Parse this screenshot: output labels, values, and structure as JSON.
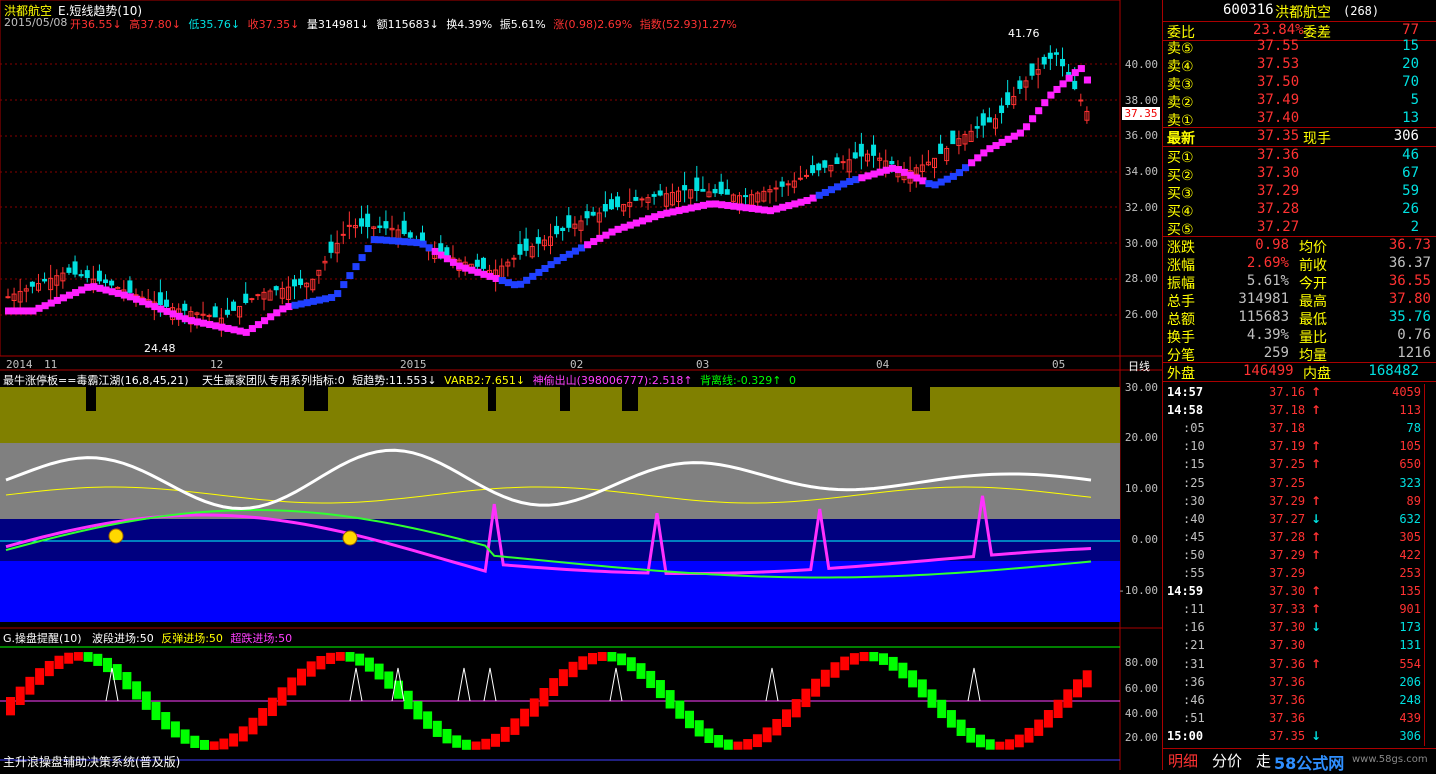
{
  "header": {
    "stock_name": "洪都航空",
    "indicator": "E.短线趋势(10)",
    "date": "2015/05/08",
    "quote": [
      {
        "label": "开",
        "value": "36.55",
        "arrow": "↓",
        "color": "red"
      },
      {
        "label": "高",
        "value": "37.80",
        "arrow": "↓",
        "color": "red"
      },
      {
        "label": "低",
        "value": "35.76",
        "arrow": "↓",
        "color": "cyan"
      },
      {
        "label": "收",
        "value": "37.35",
        "arrow": "↓",
        "color": "red"
      },
      {
        "label": "量",
        "value": "314981",
        "arrow": "↓",
        "color": "white"
      },
      {
        "label": "额",
        "value": "115683",
        "arrow": "↓",
        "color": "white"
      },
      {
        "label": "换",
        "value": "4.39%",
        "arrow": "",
        "color": "white"
      },
      {
        "label": "振",
        "value": "5.61%",
        "arrow": "",
        "color": "white"
      },
      {
        "label": "涨",
        "value": "(0.98)2.69%",
        "arrow": "",
        "color": "red"
      },
      {
        "label": "指数",
        "value": "(52.93)1.27%",
        "arrow": "",
        "color": "red"
      }
    ]
  },
  "main_chart": {
    "high_label": "41.76",
    "low_label": "24.48",
    "price_tag": "37.35",
    "y_ticks": [
      "40.00",
      "38.00",
      "36.00",
      "34.00",
      "32.00",
      "30.00",
      "28.00",
      "26.00"
    ],
    "x_labels": [
      "2014",
      "11",
      "12",
      "2015",
      "02",
      "03",
      "04",
      "05"
    ],
    "period": "日线"
  },
  "sub1": {
    "title": "最牛涨停板==毒霸江湖(16,8,45,21)",
    "parts": [
      {
        "text": "天生赢家团队专用系列指标:0",
        "color": "white"
      },
      {
        "text": "短趋势:11.553↓",
        "color": "white"
      },
      {
        "text": "VARB2:7.651↓",
        "color": "yellow"
      },
      {
        "text": "神偷出山(398006777):2.518↑",
        "color": "magenta"
      },
      {
        "text": "背离线:-0.329↑",
        "color": "green"
      },
      {
        "text": "0",
        "color": "green"
      }
    ],
    "y_ticks": [
      "30.00",
      "20.00",
      "10.00",
      "0.00",
      "-10.00"
    ]
  },
  "sub2": {
    "title": "G.操盘提醒(10)",
    "parts": [
      {
        "text": "波段进场:50",
        "color": "white"
      },
      {
        "text": "反弹进场:50",
        "color": "yellow"
      },
      {
        "text": "超跌进场:50",
        "color": "magenta"
      }
    ],
    "y_ticks": [
      "80.00",
      "60.00",
      "40.00",
      "20.00"
    ]
  },
  "footer": "主升浪操盘辅助决策系统(普及版)",
  "quote_panel": {
    "code": "600316",
    "name": "洪都航空",
    "flag": "(268)",
    "webi_label": "委比",
    "webi_value": "23.84%",
    "weicha_label": "委差",
    "weicha_value": "77",
    "asks": [
      {
        "label": "卖⑤",
        "price": "37.55",
        "vol": "15"
      },
      {
        "label": "卖④",
        "price": "37.53",
        "vol": "20"
      },
      {
        "label": "卖③",
        "price": "37.50",
        "vol": "70"
      },
      {
        "label": "卖②",
        "price": "37.49",
        "vol": "5"
      },
      {
        "label": "卖①",
        "price": "37.40",
        "vol": "13"
      }
    ],
    "last_label": "最新",
    "last_price": "37.35",
    "hand_label": "现手",
    "hand_value": "306",
    "bids": [
      {
        "label": "买①",
        "price": "37.36",
        "vol": "46"
      },
      {
        "label": "买②",
        "price": "37.30",
        "vol": "67"
      },
      {
        "label": "买③",
        "price": "37.29",
        "vol": "59"
      },
      {
        "label": "买④",
        "price": "37.28",
        "vol": "26"
      },
      {
        "label": "买⑤",
        "price": "37.27",
        "vol": "2"
      }
    ],
    "stats": [
      {
        "l1": "涨跌",
        "v1": "0.98",
        "c1": "red",
        "l2": "均价",
        "v2": "36.73",
        "c2": "red"
      },
      {
        "l1": "涨幅",
        "v1": "2.69%",
        "c1": "red",
        "l2": "前收",
        "v2": "36.37",
        "c2": "grey"
      },
      {
        "l1": "振幅",
        "v1": "5.61%",
        "c1": "grey",
        "l2": "今开",
        "v2": "36.55",
        "c2": "red"
      },
      {
        "l1": "总手",
        "v1": "314981",
        "c1": "grey",
        "l2": "最高",
        "v2": "37.80",
        "c2": "red"
      },
      {
        "l1": "总额",
        "v1": "115683",
        "c1": "grey",
        "l2": "最低",
        "v2": "35.76",
        "c2": "cyan"
      },
      {
        "l1": "换手",
        "v1": "4.39%",
        "c1": "grey",
        "l2": "量比",
        "v2": "0.76",
        "c2": "grey"
      },
      {
        "l1": "分笔",
        "v1": "259",
        "c1": "grey",
        "l2": "均量",
        "v2": "1216",
        "c2": "grey"
      }
    ],
    "outer_label": "外盘",
    "outer_value": "146499",
    "inner_label": "内盘",
    "inner_value": "168482",
    "ticks": [
      {
        "t": "14:57",
        "p": "37.16",
        "a": "↑",
        "v": "4059",
        "c": "red"
      },
      {
        "t": "14:58",
        "p": "37.18",
        "a": "↑",
        "v": "113",
        "c": "red"
      },
      {
        "t": ":05",
        "p": "37.18",
        "a": "",
        "v": "78",
        "c": "cyan"
      },
      {
        "t": ":10",
        "p": "37.19",
        "a": "↑",
        "v": "105",
        "c": "red"
      },
      {
        "t": ":15",
        "p": "37.25",
        "a": "↑",
        "v": "650",
        "c": "red"
      },
      {
        "t": ":25",
        "p": "37.25",
        "a": "",
        "v": "323",
        "c": "cyan"
      },
      {
        "t": ":30",
        "p": "37.29",
        "a": "↑",
        "v": "89",
        "c": "red"
      },
      {
        "t": ":40",
        "p": "37.27",
        "a": "↓",
        "v": "632",
        "c": "cyan"
      },
      {
        "t": ":45",
        "p": "37.28",
        "a": "↑",
        "v": "305",
        "c": "red"
      },
      {
        "t": ":50",
        "p": "37.29",
        "a": "↑",
        "v": "422",
        "c": "red"
      },
      {
        "t": ":55",
        "p": "37.29",
        "a": "",
        "v": "253",
        "c": "red"
      },
      {
        "t": "14:59",
        "p": "37.30",
        "a": "↑",
        "v": "135",
        "c": "red"
      },
      {
        "t": ":11",
        "p": "37.33",
        "a": "↑",
        "v": "901",
        "c": "red"
      },
      {
        "t": ":16",
        "p": "37.30",
        "a": "↓",
        "v": "173",
        "c": "cyan"
      },
      {
        "t": ":21",
        "p": "37.30",
        "a": "",
        "v": "131",
        "c": "cyan"
      },
      {
        "t": ":31",
        "p": "37.36",
        "a": "↑",
        "v": "554",
        "c": "red"
      },
      {
        "t": ":36",
        "p": "37.36",
        "a": "",
        "v": "206",
        "c": "cyan"
      },
      {
        "t": ":46",
        "p": "37.36",
        "a": "",
        "v": "248",
        "c": "cyan"
      },
      {
        "t": ":51",
        "p": "37.36",
        "a": "",
        "v": "439",
        "c": "red"
      },
      {
        "t": "15:00",
        "p": "37.35",
        "a": "↓",
        "v": "306",
        "c": "cyan"
      }
    ],
    "tabs": [
      "明细",
      "分价",
      "走"
    ],
    "watermark": "58公式网",
    "watermark_url": "www.58gs.com"
  }
}
